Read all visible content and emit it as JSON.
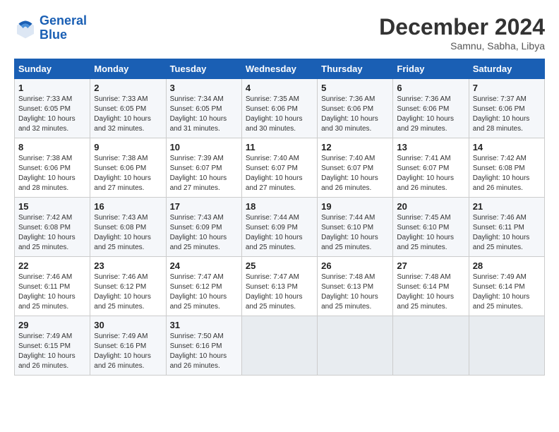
{
  "header": {
    "logo_line1": "General",
    "logo_line2": "Blue",
    "month": "December 2024",
    "location": "Samnu, Sabha, Libya"
  },
  "weekdays": [
    "Sunday",
    "Monday",
    "Tuesday",
    "Wednesday",
    "Thursday",
    "Friday",
    "Saturday"
  ],
  "weeks": [
    [
      {
        "day": "1",
        "info": "Sunrise: 7:33 AM\nSunset: 6:05 PM\nDaylight: 10 hours\nand 32 minutes."
      },
      {
        "day": "2",
        "info": "Sunrise: 7:33 AM\nSunset: 6:05 PM\nDaylight: 10 hours\nand 32 minutes."
      },
      {
        "day": "3",
        "info": "Sunrise: 7:34 AM\nSunset: 6:05 PM\nDaylight: 10 hours\nand 31 minutes."
      },
      {
        "day": "4",
        "info": "Sunrise: 7:35 AM\nSunset: 6:06 PM\nDaylight: 10 hours\nand 30 minutes."
      },
      {
        "day": "5",
        "info": "Sunrise: 7:36 AM\nSunset: 6:06 PM\nDaylight: 10 hours\nand 30 minutes."
      },
      {
        "day": "6",
        "info": "Sunrise: 7:36 AM\nSunset: 6:06 PM\nDaylight: 10 hours\nand 29 minutes."
      },
      {
        "day": "7",
        "info": "Sunrise: 7:37 AM\nSunset: 6:06 PM\nDaylight: 10 hours\nand 28 minutes."
      }
    ],
    [
      {
        "day": "8",
        "info": "Sunrise: 7:38 AM\nSunset: 6:06 PM\nDaylight: 10 hours\nand 28 minutes."
      },
      {
        "day": "9",
        "info": "Sunrise: 7:38 AM\nSunset: 6:06 PM\nDaylight: 10 hours\nand 27 minutes."
      },
      {
        "day": "10",
        "info": "Sunrise: 7:39 AM\nSunset: 6:07 PM\nDaylight: 10 hours\nand 27 minutes."
      },
      {
        "day": "11",
        "info": "Sunrise: 7:40 AM\nSunset: 6:07 PM\nDaylight: 10 hours\nand 27 minutes."
      },
      {
        "day": "12",
        "info": "Sunrise: 7:40 AM\nSunset: 6:07 PM\nDaylight: 10 hours\nand 26 minutes."
      },
      {
        "day": "13",
        "info": "Sunrise: 7:41 AM\nSunset: 6:07 PM\nDaylight: 10 hours\nand 26 minutes."
      },
      {
        "day": "14",
        "info": "Sunrise: 7:42 AM\nSunset: 6:08 PM\nDaylight: 10 hours\nand 26 minutes."
      }
    ],
    [
      {
        "day": "15",
        "info": "Sunrise: 7:42 AM\nSunset: 6:08 PM\nDaylight: 10 hours\nand 25 minutes."
      },
      {
        "day": "16",
        "info": "Sunrise: 7:43 AM\nSunset: 6:08 PM\nDaylight: 10 hours\nand 25 minutes."
      },
      {
        "day": "17",
        "info": "Sunrise: 7:43 AM\nSunset: 6:09 PM\nDaylight: 10 hours\nand 25 minutes."
      },
      {
        "day": "18",
        "info": "Sunrise: 7:44 AM\nSunset: 6:09 PM\nDaylight: 10 hours\nand 25 minutes."
      },
      {
        "day": "19",
        "info": "Sunrise: 7:44 AM\nSunset: 6:10 PM\nDaylight: 10 hours\nand 25 minutes."
      },
      {
        "day": "20",
        "info": "Sunrise: 7:45 AM\nSunset: 6:10 PM\nDaylight: 10 hours\nand 25 minutes."
      },
      {
        "day": "21",
        "info": "Sunrise: 7:46 AM\nSunset: 6:11 PM\nDaylight: 10 hours\nand 25 minutes."
      }
    ],
    [
      {
        "day": "22",
        "info": "Sunrise: 7:46 AM\nSunset: 6:11 PM\nDaylight: 10 hours\nand 25 minutes."
      },
      {
        "day": "23",
        "info": "Sunrise: 7:46 AM\nSunset: 6:12 PM\nDaylight: 10 hours\nand 25 minutes."
      },
      {
        "day": "24",
        "info": "Sunrise: 7:47 AM\nSunset: 6:12 PM\nDaylight: 10 hours\nand 25 minutes."
      },
      {
        "day": "25",
        "info": "Sunrise: 7:47 AM\nSunset: 6:13 PM\nDaylight: 10 hours\nand 25 minutes."
      },
      {
        "day": "26",
        "info": "Sunrise: 7:48 AM\nSunset: 6:13 PM\nDaylight: 10 hours\nand 25 minutes."
      },
      {
        "day": "27",
        "info": "Sunrise: 7:48 AM\nSunset: 6:14 PM\nDaylight: 10 hours\nand 25 minutes."
      },
      {
        "day": "28",
        "info": "Sunrise: 7:49 AM\nSunset: 6:14 PM\nDaylight: 10 hours\nand 25 minutes."
      }
    ],
    [
      {
        "day": "29",
        "info": "Sunrise: 7:49 AM\nSunset: 6:15 PM\nDaylight: 10 hours\nand 26 minutes."
      },
      {
        "day": "30",
        "info": "Sunrise: 7:49 AM\nSunset: 6:16 PM\nDaylight: 10 hours\nand 26 minutes."
      },
      {
        "day": "31",
        "info": "Sunrise: 7:50 AM\nSunset: 6:16 PM\nDaylight: 10 hours\nand 26 minutes."
      },
      {
        "day": "",
        "info": ""
      },
      {
        "day": "",
        "info": ""
      },
      {
        "day": "",
        "info": ""
      },
      {
        "day": "",
        "info": ""
      }
    ]
  ]
}
